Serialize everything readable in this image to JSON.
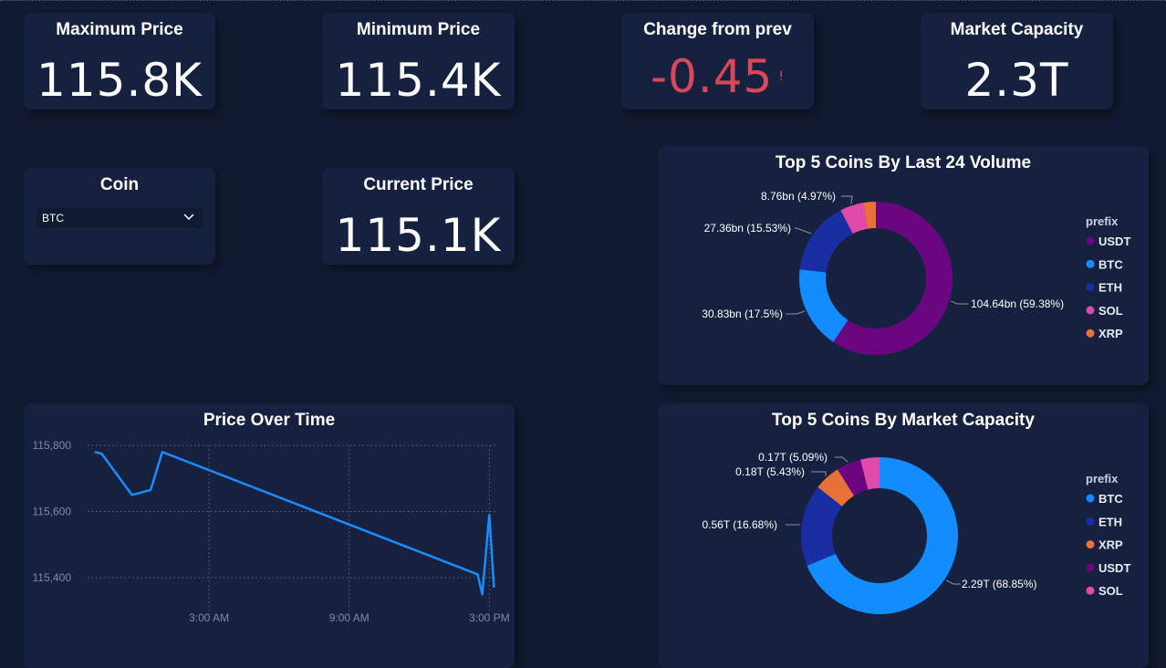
{
  "kpis": {
    "max_price": {
      "title": "Maximum Price",
      "value": "115.8K"
    },
    "min_price": {
      "title": "Minimum Price",
      "value": "115.4K"
    },
    "change": {
      "title": "Change from prev",
      "value": "-0.45",
      "mark": "!"
    },
    "market_cap": {
      "title": "Market Capacity",
      "value": "2.3T"
    },
    "current_price": {
      "title": "Current Price",
      "value": "115.1K"
    }
  },
  "coin_filter": {
    "title": "Coin",
    "selected": "BTC"
  },
  "colors": {
    "background": "#111a30",
    "card": "#15213f",
    "negative": "#d9475a",
    "line": "#1a8cff"
  },
  "chart_data": [
    {
      "type": "line",
      "title": "Price Over Time",
      "x_ticks": [
        "3:00 AM",
        "9:00 AM",
        "3:00 PM"
      ],
      "y_ticks": [
        "115,800",
        "115,600",
        "115,400"
      ],
      "ylim": [
        115400,
        115800
      ],
      "grid": true,
      "points": [
        {
          "x": 0.0,
          "y": 115780
        },
        {
          "x": 0.3,
          "y": 115775
        },
        {
          "x": 1.6,
          "y": 115650
        },
        {
          "x": 2.4,
          "y": 115665
        },
        {
          "x": 2.9,
          "y": 115780
        },
        {
          "x": 16.4,
          "y": 115410
        },
        {
          "x": 16.6,
          "y": 115350
        },
        {
          "x": 16.9,
          "y": 115590
        },
        {
          "x": 17.1,
          "y": 115370
        }
      ],
      "x_tick_positions": [
        4.9,
        10.9,
        16.9
      ],
      "xlim": [
        -0.3,
        17.2
      ]
    },
    {
      "type": "pie",
      "title": "Top 5 Coins By Last 24 Volume",
      "legend_title": "prefix",
      "legend_position": "right",
      "slices": [
        {
          "name": "USDT",
          "value": 104.64,
          "label": "104.64bn (59.38%)",
          "color": "#6a067f"
        },
        {
          "name": "BTC",
          "value": 30.83,
          "label": "30.83bn (17.5%)",
          "color": "#128cff"
        },
        {
          "name": "ETH",
          "value": 27.36,
          "label": "27.36bn (15.53%)",
          "color": "#1a2ea3"
        },
        {
          "name": "SOL",
          "value": 8.76,
          "label": "8.76bn (4.97%)",
          "color": "#e14aa9"
        },
        {
          "name": "XRP",
          "value": 4.63,
          "label": "",
          "color": "#e8713a"
        }
      ]
    },
    {
      "type": "pie",
      "title": "Top 5 Coins By Market Capacity",
      "legend_title": "prefix",
      "legend_position": "right",
      "slices": [
        {
          "name": "BTC",
          "value": 2.29,
          "label": "2.29T (68.85%)",
          "color": "#128cff"
        },
        {
          "name": "ETH",
          "value": 0.56,
          "label": "0.56T (16.68%)",
          "color": "#1a2ea3"
        },
        {
          "name": "XRP",
          "value": 0.18,
          "label": "0.18T (5.43%)",
          "color": "#e8713a"
        },
        {
          "name": "USDT",
          "value": 0.17,
          "label": "0.17T (5.09%)",
          "color": "#6a067f"
        },
        {
          "name": "SOL",
          "value": 0.13,
          "label": "",
          "color": "#e14aa9"
        }
      ]
    }
  ]
}
